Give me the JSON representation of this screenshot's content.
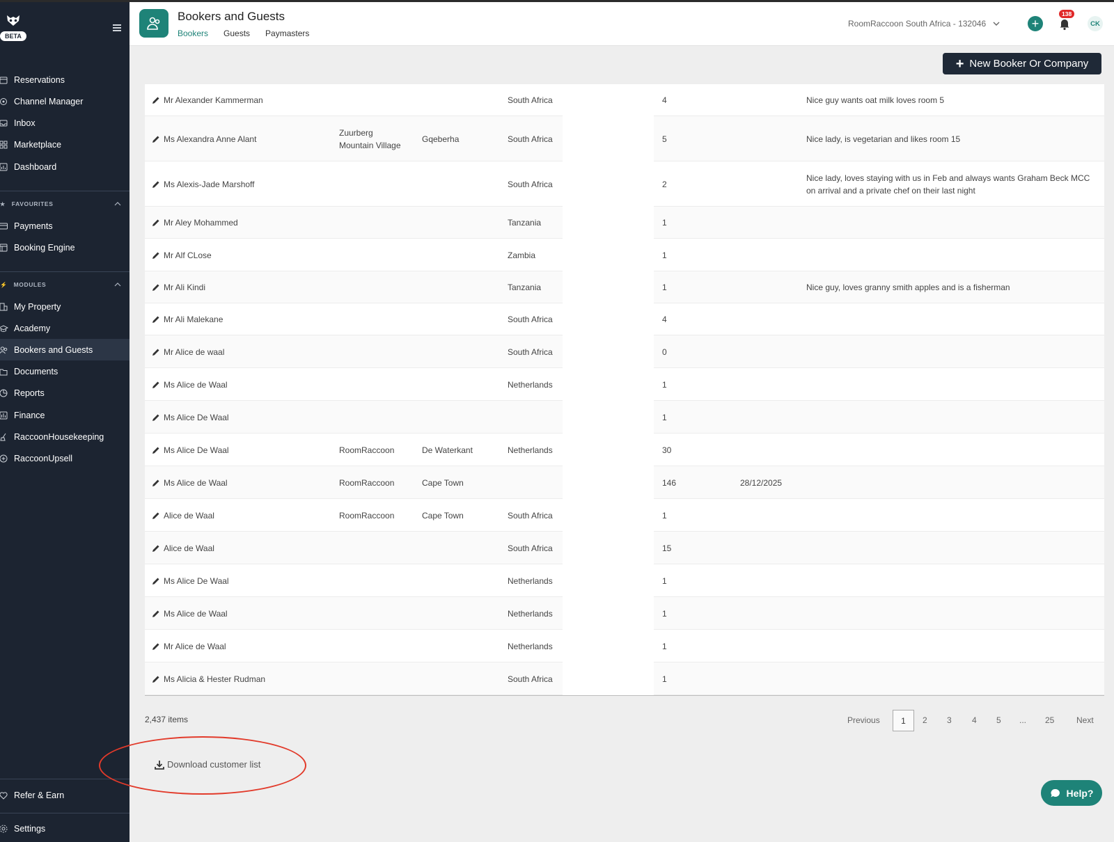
{
  "sidebar": {
    "beta_label": "BETA",
    "main_items": [
      {
        "label": "Reservations",
        "icon": "calendar-icon"
      },
      {
        "label": "Channel Manager",
        "icon": "channel-icon"
      },
      {
        "label": "Inbox",
        "icon": "inbox-icon"
      },
      {
        "label": "Marketplace",
        "icon": "grid-icon"
      },
      {
        "label": "Dashboard",
        "icon": "dashboard-icon"
      }
    ],
    "favourites_label": "FAVOURITES",
    "favourites": [
      {
        "label": "Payments",
        "icon": "card-icon"
      },
      {
        "label": "Booking Engine",
        "icon": "booking-engine-icon"
      }
    ],
    "modules_label": "MODULES",
    "modules": [
      {
        "label": "My Property",
        "icon": "building-icon"
      },
      {
        "label": "Academy",
        "icon": "academy-icon"
      },
      {
        "label": "Bookers and Guests",
        "icon": "users-icon",
        "active": true
      },
      {
        "label": "Documents",
        "icon": "documents-icon"
      },
      {
        "label": "Reports",
        "icon": "pie-chart-icon"
      },
      {
        "label": "Finance",
        "icon": "finance-icon"
      },
      {
        "label": "RaccoonHousekeeping",
        "icon": "broom-icon"
      },
      {
        "label": "RaccoonUpsell",
        "icon": "plus-circle-icon"
      }
    ],
    "refer_label": "Refer & Earn",
    "settings_label": "Settings"
  },
  "header": {
    "title": "Bookers and Guests",
    "tabs": [
      "Bookers",
      "Guests",
      "Paymasters"
    ],
    "active_tab": "Bookers",
    "property": "RoomRaccoon South Africa - 132046",
    "notification_count": "138",
    "avatar_initials": "CK"
  },
  "new_button_label": "New Booker Or Company",
  "rows": [
    {
      "name": "Mr Alexander Kammerman",
      "company": "",
      "city": "",
      "country": "South Africa",
      "stays": "4",
      "date": "",
      "notes": "Nice guy wants oat milk loves room 5"
    },
    {
      "name": "Ms Alexandra Anne Alant",
      "company": "Zuurberg Mountain Village",
      "city": "Gqeberha",
      "country": "South Africa",
      "stays": "5",
      "date": "",
      "notes": "Nice lady, is vegetarian and likes room 15"
    },
    {
      "name": "Ms Alexis-Jade Marshoff",
      "company": "",
      "city": "",
      "country": "South Africa",
      "stays": "2",
      "date": "",
      "notes": "Nice lady, loves staying with us in Feb and always wants Graham Beck MCC on arrival and a private chef on their last night"
    },
    {
      "name": "Mr Aley Mohammed",
      "company": "",
      "city": "",
      "country": "Tanzania",
      "stays": "1",
      "date": "",
      "notes": ""
    },
    {
      "name": "Mr Alf CLose",
      "company": "",
      "city": "",
      "country": "Zambia",
      "stays": "1",
      "date": "",
      "notes": ""
    },
    {
      "name": "Mr Ali Kindi",
      "company": "",
      "city": "",
      "country": "Tanzania",
      "stays": "1",
      "date": "",
      "notes": "Nice guy, loves granny smith apples and is a fisherman"
    },
    {
      "name": "Mr Ali Malekane",
      "company": "",
      "city": "",
      "country": "South Africa",
      "stays": "4",
      "date": "",
      "notes": ""
    },
    {
      "name": "Mr Alice de waal",
      "company": "",
      "city": "",
      "country": "South Africa",
      "stays": "0",
      "date": "",
      "notes": ""
    },
    {
      "name": "Ms Alice de Waal",
      "company": "",
      "city": "",
      "country": "Netherlands",
      "stays": "1",
      "date": "",
      "notes": ""
    },
    {
      "name": "Ms Alice De Waal",
      "company": "",
      "city": "",
      "country": "",
      "stays": "1",
      "date": "",
      "notes": ""
    },
    {
      "name": "Ms Alice De Waal",
      "company": "RoomRaccoon",
      "city": "De Waterkant",
      "country": "Netherlands",
      "stays": "30",
      "date": "",
      "notes": ""
    },
    {
      "name": "Ms Alice de Waal",
      "company": "RoomRaccoon",
      "city": "Cape Town",
      "country": "",
      "stays": "146",
      "date": "28/12/2025",
      "notes": ""
    },
    {
      "name": " Alice de Waal",
      "company": "RoomRaccoon",
      "city": "Cape Town",
      "country": "South Africa",
      "stays": "1",
      "date": "",
      "notes": ""
    },
    {
      "name": " Alice de Waal",
      "company": "",
      "city": "",
      "country": "South Africa",
      "stays": "15",
      "date": "",
      "notes": ""
    },
    {
      "name": "Ms Alice De Waal",
      "company": "",
      "city": "",
      "country": "Netherlands",
      "stays": "1",
      "date": "",
      "notes": ""
    },
    {
      "name": "Ms Alice de Waal",
      "company": "",
      "city": "",
      "country": "Netherlands",
      "stays": "1",
      "date": "",
      "notes": ""
    },
    {
      "name": "Mr Alice de Waal",
      "company": "",
      "city": "",
      "country": "Netherlands",
      "stays": "1",
      "date": "",
      "notes": ""
    },
    {
      "name": "Ms Alicia & Hester Rudman",
      "company": "",
      "city": "",
      "country": "South Africa",
      "stays": "1",
      "date": "",
      "notes": ""
    }
  ],
  "items_count": "2,437 items",
  "pagination": {
    "previous": "Previous",
    "pages": [
      "1",
      "2",
      "3",
      "4",
      "5",
      "...",
      "25"
    ],
    "current": "1",
    "next": "Next"
  },
  "download_label": "Download customer list",
  "help_label": "Help?",
  "colors": {
    "sidebar_bg": "#1c2431",
    "accent": "#1e8378",
    "annotation": "#e23a2a",
    "badge": "#e02828"
  }
}
